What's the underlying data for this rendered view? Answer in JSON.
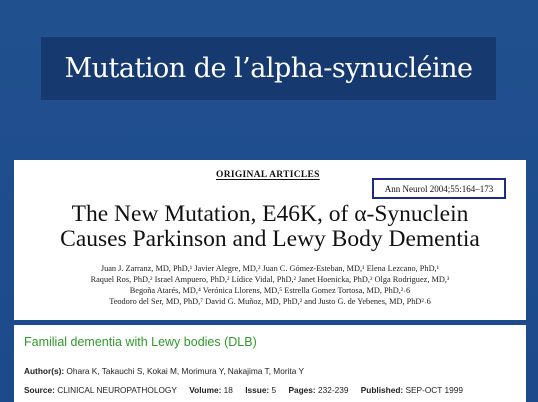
{
  "slide": {
    "title": "Mutation de l’alpha-synucléine"
  },
  "paper": {
    "section_label": "ORIGINAL ARTICLES",
    "citation": "Ann Neurol 2004;55:164–173",
    "title_line1": "The New Mutation, E46K, of α-Synuclein",
    "title_line2": "Causes Parkinson and Lewy Body Dementia",
    "authors_line1": "Juan J. Zarranz, MD, PhD,¹ Javier Alegre, MD,² Juan C. Gómez-Esteban, MD,¹ Elena Lezcano, PhD,¹",
    "authors_line2": "Raquel Ros, PhD,² Israel Ampuero, PhD,² Lídice Vidal, PhD,² Janet Hoenicka, PhD,² Olga Rodriguez, MD,³",
    "authors_line3": "Begoña Atarés, MD,⁴ Verónica Llorens, MD,⁵ Estrella Gomez Tortosa, MD, PhD,²˒6",
    "authors_line4": "Teodoro del Ser, MD, PhD,⁷ David G. Muñoz, MD, PhD,² and Justo G. de Yebenes, MD, PhD²˒6"
  },
  "database_record": {
    "title": "Familial dementia with Lewy bodies (DLB)",
    "authors_label": "Author(s):",
    "authors_value": "Ohara K, Takauchi S, Kokai M, Morimura Y, Nakajima T, Morita Y",
    "source_label": "Source:",
    "source_value": "CLINICAL NEUROPATHOLOGY",
    "volume_label": "Volume:",
    "volume_value": "18",
    "issue_label": "Issue:",
    "issue_value": "5",
    "pages_label": "Pages:",
    "pages_value": "232-239",
    "published_label": "Published:",
    "published_value": "SEP-OCT 1999",
    "title_color": "#2f9a2b"
  }
}
